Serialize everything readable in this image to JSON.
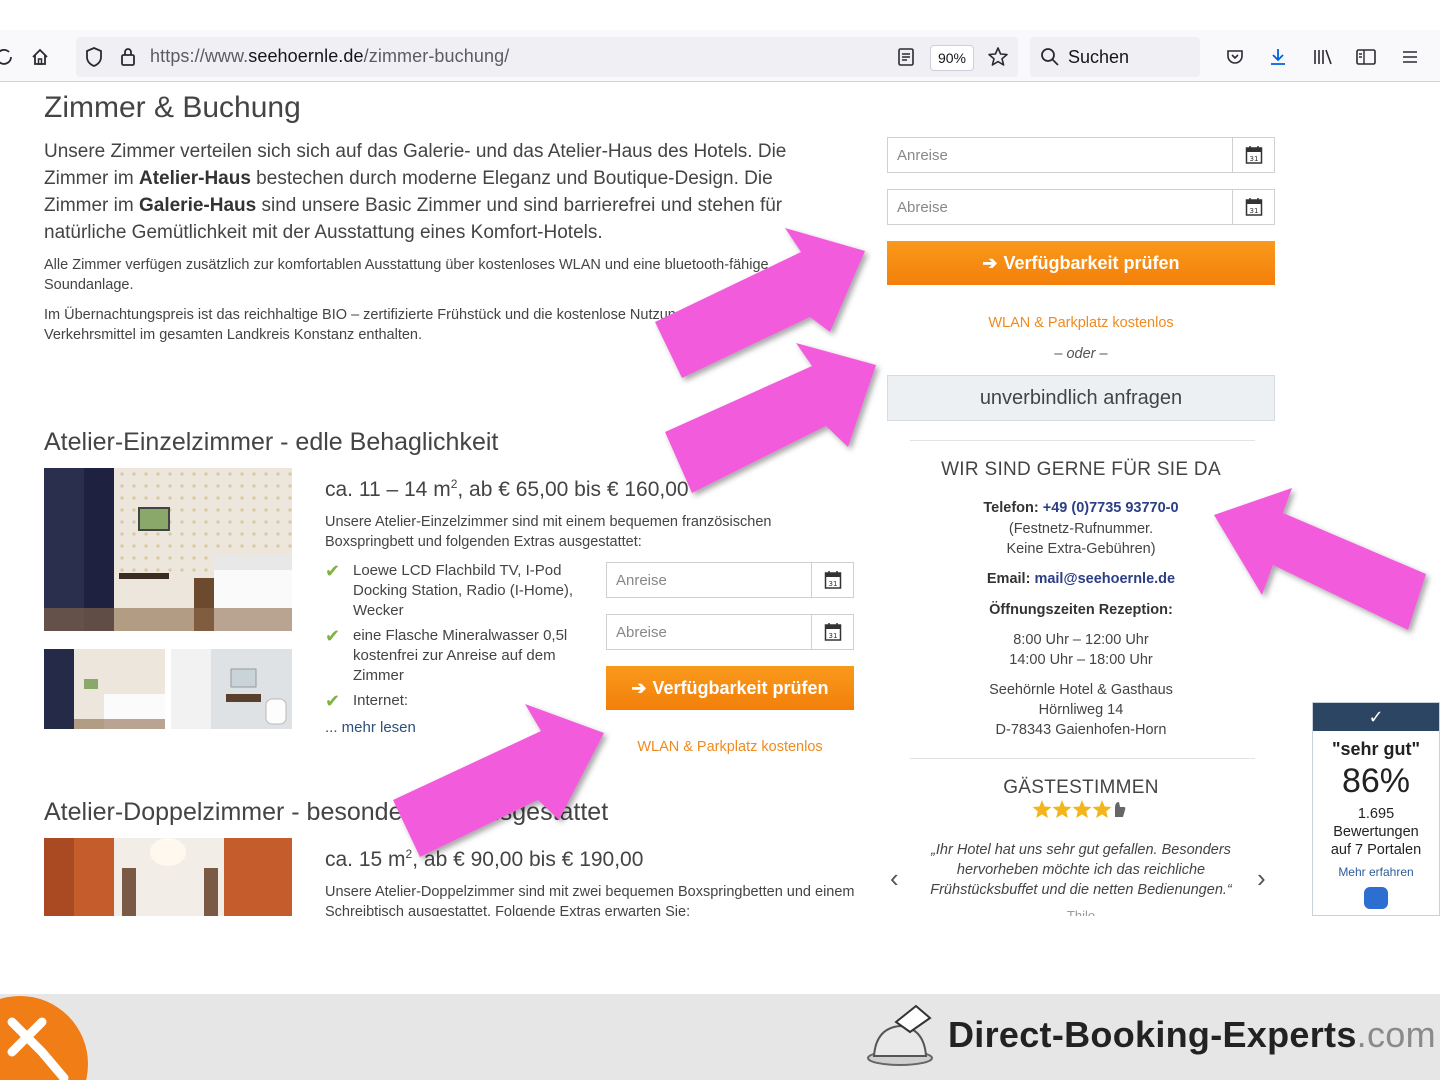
{
  "browser": {
    "url_prefix": "https://www.",
    "url_domain": "seehoernle.de",
    "url_path": "/zimmer-buchung/",
    "zoom": "90%",
    "search_label": "Suchen"
  },
  "page": {
    "title": "Zimmer & Buchung",
    "intro_1": "Unsere Zimmer verteilen sich sich auf das Galerie- und das Atelier-Haus des Hotels. Die Zimmer im ",
    "intro_atelier": "Atelier-Haus",
    "intro_2": " bestechen durch moderne Eleganz und Boutique-Design. Die Zimmer im ",
    "intro_galerie": "Galerie-Haus",
    "intro_3": " sind unsere Basic Zimmer und sind barrierefrei und stehen für natürliche Gemütlichkeit mit der Ausstattung eines Komfort-Hotels.",
    "para_1": "Alle Zimmer verfügen zusätzlich zur komfortablen Ausstattung über kostenloses WLAN und eine bluetooth-fähige Soundanlage.",
    "para_2": "Im Übernachtungspreis ist das reichhaltige BIO – zertifizierte Frühstück und die kostenlose Nutzung öffentlicher Verkehrsmittel im gesamten Landkreis Konstanz enthalten."
  },
  "room1": {
    "heading": "Atelier-Einzelzimmer - edle Behaglichkeit",
    "price_a": "ca. 11 – 14 m",
    "price_sup": "2",
    "price_b": ", ab € 65,00 bis € 160,00",
    "desc": "Unsere Atelier-Einzelzimmer sind mit einem bequemen französischen Boxspringbett und folgenden Extras ausgestattet:",
    "features": [
      "Loewe LCD Flachbild TV, I-Pod Docking Station, Radio (I-Home), Wecker",
      "eine Flasche Mineralwasser 0,5l kostenfrei zur Anreise auf dem Zimmer",
      "Internet:"
    ],
    "more": "... mehr lesen",
    "arrival_placeholder": "Anreise",
    "departure_placeholder": "Abreise",
    "check_button": "Verfügbarkeit prüfen",
    "wlan_note": "WLAN & Parkplatz kostenlos"
  },
  "room2": {
    "heading": "Atelier-Doppelzimmer - besonders gut ausgestattet",
    "price_a": "ca. 15 m",
    "price_sup": "2",
    "price_b": ", ab € 90,00 bis € 190,00",
    "desc": "Unsere Atelier-Doppelzimmer sind mit zwei bequemen Boxspringbetten und einem Schreibtisch ausgestattet. Folgende Extras erwarten Sie:"
  },
  "sidebar": {
    "arrival_placeholder": "Anreise",
    "departure_placeholder": "Abreise",
    "check_button": "Verfügbarkeit prüfen",
    "wlan_note": "WLAN & Parkplatz kostenlos",
    "or": "– oder –",
    "inquire_button": "unverbindlich anfragen",
    "contact_heading": "WIR SIND GERNE FÜR SIE DA",
    "phone_label": "Telefon: ",
    "phone": "+49 (0)7735 93770-0",
    "phone_note_1": "(Festnetz-Rufnummer.",
    "phone_note_2": "Keine Extra-Gebühren)",
    "email_label": "Email: ",
    "email": "mail@seehoernle.de",
    "hours_label": "Öffnungszeiten Rezeption:",
    "hours_1": "8:00 Uhr – 12:00 Uhr",
    "hours_2": "14:00 Uhr – 18:00 Uhr",
    "addr_1": "Seehörnle Hotel & Gasthaus",
    "addr_2": "Hörnliweg 14",
    "addr_3": "D-78343 Gaienhofen-Horn",
    "guest_heading": "GÄSTESTIMMEN",
    "rating_stars": 4.5,
    "quote": "„Ihr Hotel hat uns sehr gut gefallen. Besonders hervorheben möchte ich das reichliche Frühstücksbuffet und die netten Bedienungen.“",
    "quote_author": "Thilo"
  },
  "widget": {
    "label": "\"sehr gut\"",
    "percent": "86%",
    "count": "1.695",
    "count_label": "Bewertungen",
    "portals": "auf 7 Portalen",
    "more": "Mehr erfahren"
  },
  "footer": {
    "brand": "Direct-Booking-Experts",
    "brand_tld": ".com"
  },
  "colors": {
    "accent_orange": "#f5871f",
    "highlight_arrow": "#f25bdc",
    "link_blue": "#2c3e85"
  }
}
